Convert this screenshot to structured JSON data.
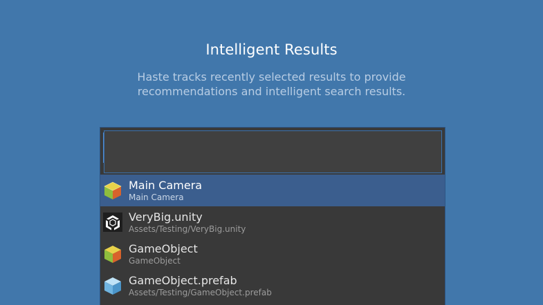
{
  "header": {
    "title": "Intelligent Results",
    "subtitle_line1": "Haste tracks recently selected results to provide",
    "subtitle_line2": "recommendations and intelligent search results."
  },
  "search": {
    "value": ""
  },
  "results": [
    {
      "name": "Main Camera",
      "path": "Main Camera",
      "icon": "gameobject-cube-icon",
      "selected": true
    },
    {
      "name": "VeryBig.unity",
      "path": "Assets/Testing/VeryBig.unity",
      "icon": "unity-logo-icon",
      "selected": false
    },
    {
      "name": "GameObject",
      "path": "GameObject",
      "icon": "gameobject-cube-icon",
      "selected": false
    },
    {
      "name": "GameObject.prefab",
      "path": "Assets/Testing/GameObject.prefab",
      "icon": "prefab-cube-icon",
      "selected": false
    }
  ],
  "colors": {
    "background": "#4177ab",
    "panel": "#393939",
    "selection": "#3b5e8e",
    "accent": "#3a71ad"
  }
}
